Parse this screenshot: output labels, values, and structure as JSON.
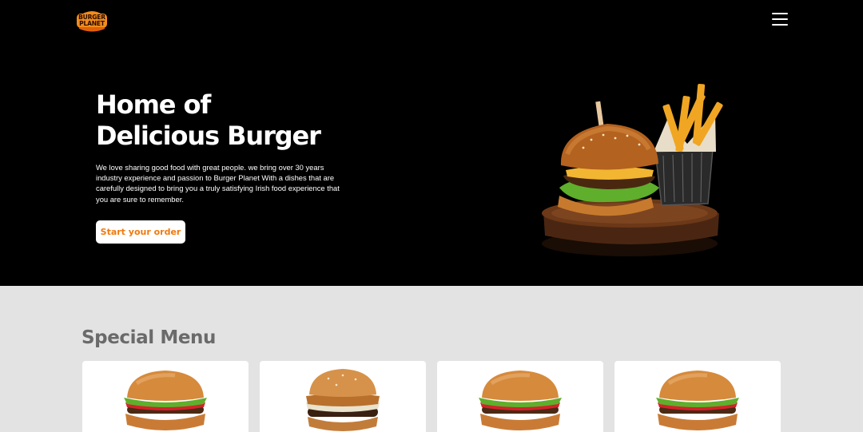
{
  "header": {
    "logo": {
      "line1": "BURGER",
      "line2": "PLANET",
      "icon": "burger-planet-logo"
    },
    "menu_icon": "hamburger-menu-icon"
  },
  "hero": {
    "title_line1": "Home of",
    "title_line2": "Delicious Burger",
    "description": "We love sharing good food with great people. we bring over 30 years industry experience and passion to Burger Planet With a dishes that are carefully designed to bring you a truly satisfying Irish food experience that you are sure to remember.",
    "cta_label": "Start your order",
    "image": "burger-and-fries-image"
  },
  "special_menu": {
    "title": "Special Menu",
    "items": [
      {
        "image": "burger-image"
      },
      {
        "image": "crispy-onion-burger-image"
      },
      {
        "image": "burger-image"
      },
      {
        "image": "burger-image"
      }
    ]
  },
  "colors": {
    "hero_bg": "#000000",
    "page_bg": "#e3e3e3",
    "accent": "#f07a0e",
    "section_title": "#6a6a6a"
  }
}
